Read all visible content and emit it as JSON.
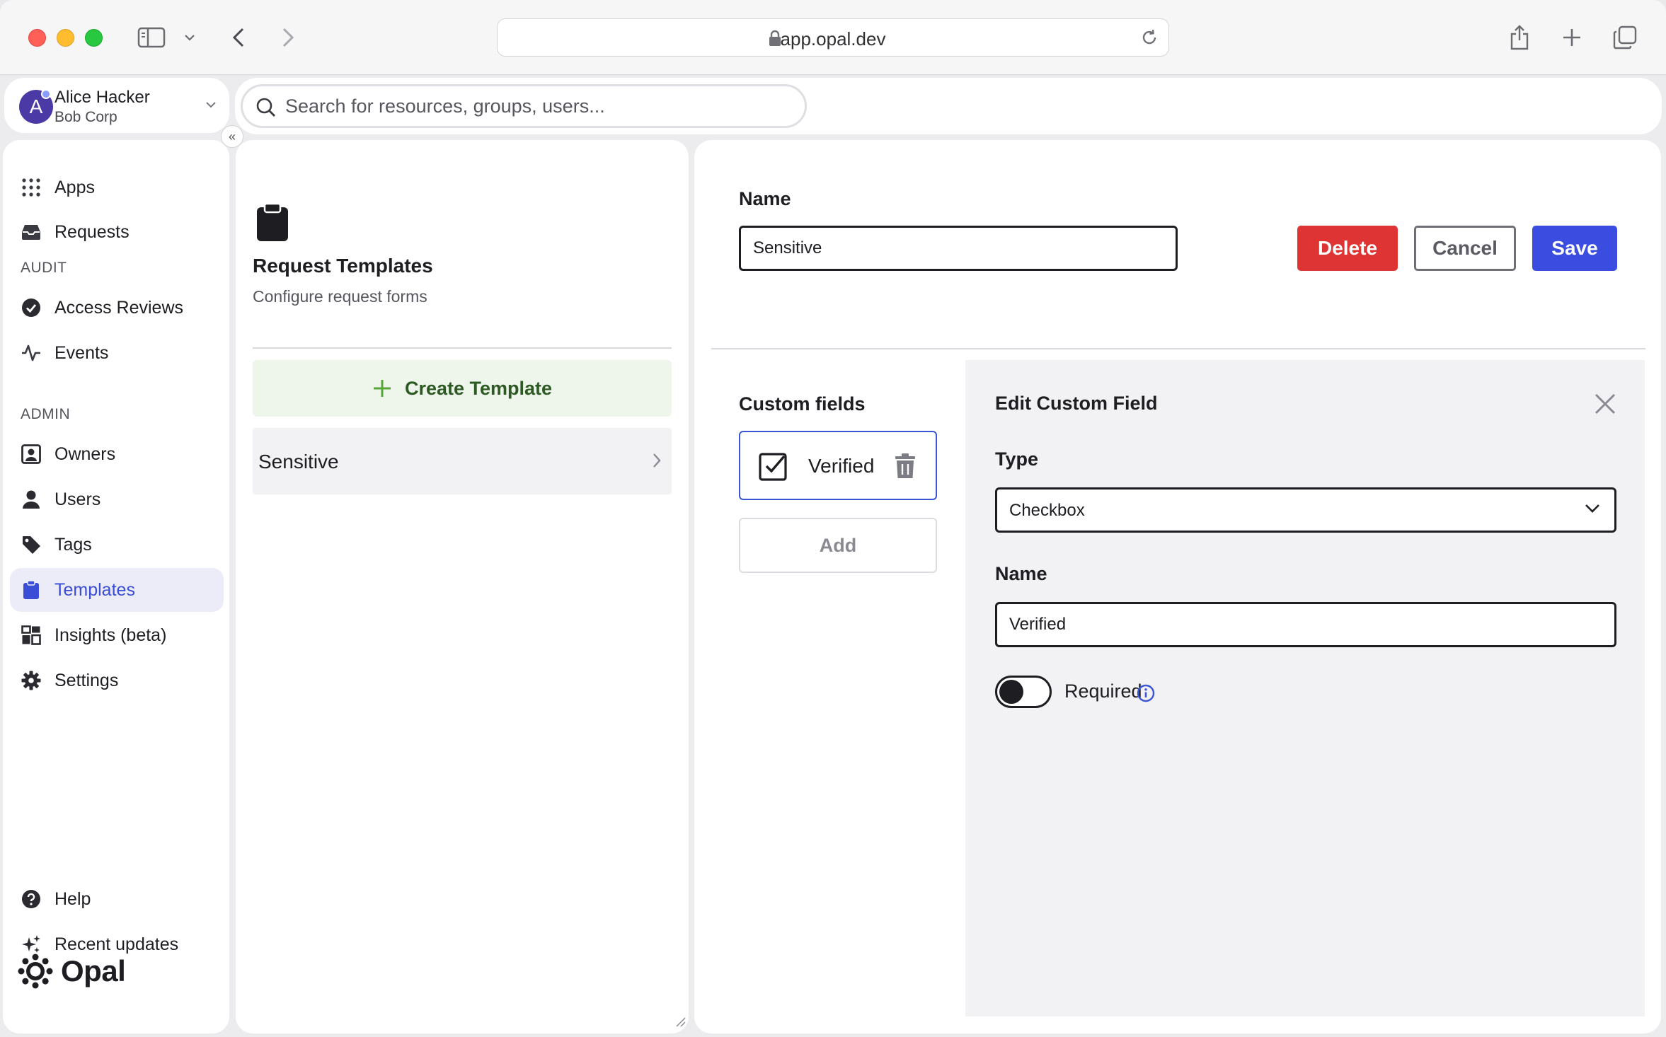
{
  "browser": {
    "url": "app.opal.dev"
  },
  "user": {
    "name": "Alice Hacker",
    "org": "Bob Corp",
    "initial": "A"
  },
  "collapse_label": "«",
  "search": {
    "placeholder": "Search for resources, groups, users..."
  },
  "sidebar": {
    "items_top": [
      {
        "label": "Apps",
        "icon": "apps-grid-icon"
      },
      {
        "label": "Requests",
        "icon": "inbox-icon"
      }
    ],
    "audit_label": "AUDIT",
    "audit_items": [
      {
        "label": "Access Reviews",
        "icon": "check-circle-icon"
      },
      {
        "label": "Events",
        "icon": "activity-icon"
      }
    ],
    "admin_label": "ADMIN",
    "admin_items": [
      {
        "label": "Owners",
        "icon": "owner-badge-icon"
      },
      {
        "label": "Users",
        "icon": "user-icon"
      },
      {
        "label": "Tags",
        "icon": "tag-icon"
      },
      {
        "label": "Templates",
        "icon": "clipboard-icon",
        "active": true
      },
      {
        "label": "Insights (beta)",
        "icon": "insights-icon"
      },
      {
        "label": "Settings",
        "icon": "gear-icon"
      }
    ],
    "bottom_items": [
      {
        "label": "Help",
        "icon": "help-icon"
      },
      {
        "label": "Recent updates",
        "icon": "sparkle-icon"
      }
    ],
    "brand": "Opal"
  },
  "templates_panel": {
    "title": "Request Templates",
    "subtitle": "Configure request forms",
    "create_label": "Create Template",
    "templates": [
      {
        "name": "Sensitive"
      }
    ]
  },
  "editor": {
    "name_label": "Name",
    "name_value": "Sensitive",
    "delete_label": "Delete",
    "cancel_label": "Cancel",
    "save_label": "Save",
    "custom_fields_label": "Custom fields",
    "custom_fields": [
      {
        "name": "Verified"
      }
    ],
    "add_label": "Add",
    "edit_field": {
      "title": "Edit Custom Field",
      "type_label": "Type",
      "type_value": "Checkbox",
      "name_label": "Name",
      "name_value": "Verified",
      "required_label": "Required",
      "required": false
    }
  },
  "colors": {
    "accent": "#3b4de0",
    "danger": "#df3434",
    "create_green": "#2d5a22",
    "active_nav_bg": "#ececf9"
  }
}
